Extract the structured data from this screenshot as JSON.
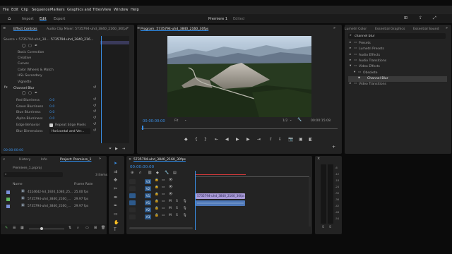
{
  "menu": [
    "File",
    "Edit",
    "Clip",
    "Sequence",
    "Markers",
    "Graphics and Titles",
    "View",
    "Window",
    "Help"
  ],
  "workspace": {
    "tabs": [
      "Import",
      "Edit",
      "Export"
    ],
    "title": "Premiere 1",
    "status": "Edited"
  },
  "effect_controls": {
    "tabs": [
      "Effect Controls",
      "Audio Clip Mixer: 5735794-uhd_3840_2160_30fps"
    ],
    "source": "Source • 5735794-uhd_38...",
    "clip": "5735794-uhd_3840_216...",
    "time": "00:00",
    "props": [
      "Basic Correction",
      "Creative",
      "Curves",
      "Color Wheels & Match",
      "HSL Secondary",
      "Vignette"
    ],
    "effect": "Channel Blur",
    "params": [
      {
        "name": "Red Blurriness",
        "value": "0.0"
      },
      {
        "name": "Green Blurriness",
        "value": "0.0"
      },
      {
        "name": "Blue Blurriness",
        "value": "0.0"
      },
      {
        "name": "Alpha Blurriness",
        "value": "0.0"
      }
    ],
    "edge_label": "Edge Behavior",
    "edge_check": "Repeat Edge Pixels",
    "dim_label": "Blur Dimensions",
    "dim_value": "Horizontal and Ver...",
    "timecode": "00:00:00:00"
  },
  "program": {
    "title": "Program: 5735794-uhd_3840_2160_30fps",
    "timecode": "00:00:00:00",
    "fit": "Fit",
    "ratio": "1/2",
    "duration": "00:00:15:08"
  },
  "effects": {
    "tabs": [
      "Lumetri Color",
      "Essential Graphics",
      "Essential Sound"
    ],
    "search": "channel blur",
    "tree": [
      {
        "label": "Presets",
        "indent": 0
      },
      {
        "label": "Lumetri Presets",
        "indent": 0
      },
      {
        "label": "Audio Effects",
        "indent": 0
      },
      {
        "label": "Audio Transitions",
        "indent": 0
      },
      {
        "label": "Video Effects",
        "indent": 0
      },
      {
        "label": "Obsolete",
        "indent": 1
      },
      {
        "label": "Channel Blur",
        "indent": 2,
        "selected": true
      },
      {
        "label": "Video Transitions",
        "indent": 0
      }
    ]
  },
  "project": {
    "tabs": [
      "History",
      "Info",
      "Project: Premiere_1"
    ],
    "file": "Premiere_1.prproj",
    "items_count": "3 items",
    "col_name": "Name",
    "col_rate": "Frame Rate",
    "files": [
      {
        "name": "4524642-hd_1920_1080_25...",
        "rate": "25.00 fps",
        "color": "#7a8fd8"
      },
      {
        "name": "5735794-uhd_3840_2160_...",
        "rate": "29.97 fps",
        "color": "#5fb85f"
      },
      {
        "name": "5735794-uhd_3840_2160_...",
        "rate": "29.97 fps",
        "color": "#7a8fd8"
      }
    ]
  },
  "timeline": {
    "tab": "5735794-uhd_3840_2160_30fps",
    "timecode": "00:00:00:00",
    "video_tracks": [
      "V3",
      "V2",
      "V1"
    ],
    "audio_tracks": [
      "A1",
      "A2",
      "A3"
    ],
    "clip_v": "5735794-uhd_3840_2160_30fps",
    "meter_labels": [
      "-6",
      "-12",
      "-18",
      "-24",
      "-30",
      "-36",
      "-42",
      "-48",
      "-54"
    ],
    "meter_foot": [
      "S",
      "S"
    ]
  }
}
